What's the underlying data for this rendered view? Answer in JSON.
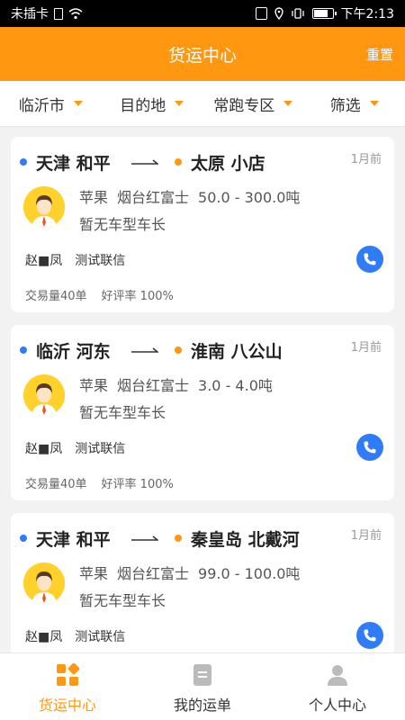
{
  "status_bar": {
    "carrier": "未插卡",
    "time": "下午2:13"
  },
  "header": {
    "title": "货运中心",
    "reset_label": "重置"
  },
  "filters": [
    {
      "label": "临沂市"
    },
    {
      "label": "目的地"
    },
    {
      "label": "常跑专区"
    },
    {
      "label": "筛选"
    }
  ],
  "cards": [
    {
      "from": "天津 和平",
      "to": "太原 小店",
      "time": "1月前",
      "goods_name": "苹果",
      "goods_type": "烟台红富士",
      "weight": "50.0 - 300.0吨",
      "truck": "暂无车型车长",
      "contact_name": "赵■凤",
      "company": "测试联信",
      "trades": "交易量40单",
      "rating": "好评率 100%"
    },
    {
      "from": "临沂 河东",
      "to": "淮南 八公山",
      "time": "1月前",
      "goods_name": "苹果",
      "goods_type": "烟台红富士",
      "weight": "3.0 - 4.0吨",
      "truck": "暂无车型车长",
      "contact_name": "赵■凤",
      "company": "测试联信",
      "trades": "交易量40单",
      "rating": "好评率 100%"
    },
    {
      "from": "天津 和平",
      "to": "秦皇岛 北戴河",
      "time": "1月前",
      "goods_name": "苹果",
      "goods_type": "烟台红富士",
      "weight": "99.0 - 100.0吨",
      "truck": "暂无车型车长",
      "contact_name": "赵■凤",
      "company": "测试联信",
      "trades": "",
      "rating": ""
    }
  ],
  "tabs": [
    {
      "label": "货运中心",
      "icon": "grid-icon"
    },
    {
      "label": "我的运单",
      "icon": "document-icon"
    },
    {
      "label": "个人中心",
      "icon": "person-icon"
    }
  ],
  "colors": {
    "accent": "#ff9810",
    "blue": "#2f7cf6"
  }
}
